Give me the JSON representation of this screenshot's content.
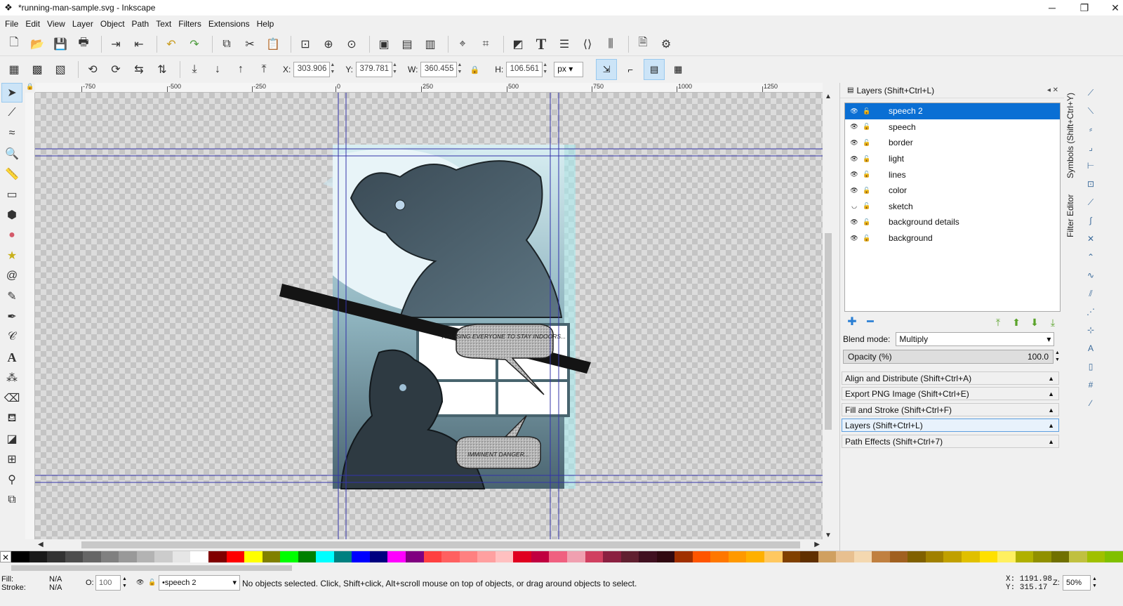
{
  "window": {
    "title": "*running-man-sample.svg - Inkscape",
    "app_icon": "inkscape-icon",
    "controls": [
      "minimize",
      "restore",
      "close"
    ]
  },
  "menu": [
    "File",
    "Edit",
    "View",
    "Layer",
    "Object",
    "Path",
    "Text",
    "Filters",
    "Extensions",
    "Help"
  ],
  "toolbar": {
    "buttons": [
      "new-document",
      "open",
      "save",
      "print",
      "import",
      "export",
      "undo",
      "redo",
      "duplicate",
      "cut",
      "paste",
      "zoom-selection",
      "zoom-drawing",
      "zoom-page",
      "group",
      "ungroup",
      "clone",
      "unlink-clone",
      "align-nodes",
      "xml-editor",
      "text-tool",
      "layers",
      "xml",
      "align-distribute",
      "preferences",
      "document-properties"
    ]
  },
  "tool_controls": {
    "x_label": "X:",
    "x_value": "303.906",
    "y_label": "Y:",
    "y_value": "379.781",
    "w_label": "W:",
    "w_value": "360.455",
    "h_label": "H:",
    "h_value": "106.561",
    "unit": "px"
  },
  "ruler_labels": [
    "-750",
    "-500",
    "-250",
    "0",
    "250",
    "500",
    "750",
    "1000",
    "1250"
  ],
  "artwork": {
    "speech_bubble_1": "ADVISING EVERYONE TO STAY INDOORS...",
    "speech_bubble_2": "IMMINENT DANGER..."
  },
  "layers_panel": {
    "title": "Layers (Shift+Ctrl+L)",
    "layers": [
      {
        "name": "speech 2",
        "selected": true
      },
      {
        "name": "speech",
        "selected": false
      },
      {
        "name": "border",
        "selected": false
      },
      {
        "name": "light",
        "selected": false
      },
      {
        "name": "lines",
        "selected": false
      },
      {
        "name": "color",
        "selected": false
      },
      {
        "name": "sketch",
        "selected": false
      },
      {
        "name": "background details",
        "selected": false
      },
      {
        "name": "background",
        "selected": false
      }
    ],
    "blend_mode_label": "Blend mode:",
    "blend_mode_value": "Multiply",
    "opacity_label": "Opacity (%)",
    "opacity_value": "100.0"
  },
  "collapsed_panels": [
    "Align and Distribute (Shift+Ctrl+A)",
    "Export PNG Image (Shift+Ctrl+E)",
    "Fill and Stroke (Shift+Ctrl+F)",
    "Layers (Shift+Ctrl+L)",
    "Path Effects  (Shift+Ctrl+7)"
  ],
  "vertical_tabs": {
    "symbols": "Symbols (Shift+Ctrl+Y)",
    "filter_editor": "Filter Editor"
  },
  "status": {
    "fill_label": "Fill:",
    "fill_value": "N/A",
    "stroke_label": "Stroke:",
    "stroke_value": "N/A",
    "opacity_label": "O:",
    "opacity_value": "100",
    "current_layer": "•speech 2",
    "message": "No objects selected. Click, Shift+click, Alt+scroll mouse on top of objects, or drag around objects to select.",
    "cursor_x": "X: 1191.98",
    "cursor_y": "Y:  315.17",
    "zoom_label": "Z:",
    "zoom_value": "50%"
  },
  "colors": {
    "accent": "#0a6fd4",
    "selection_blue": "#cce4f7",
    "guide_blue": "#3333aa"
  }
}
